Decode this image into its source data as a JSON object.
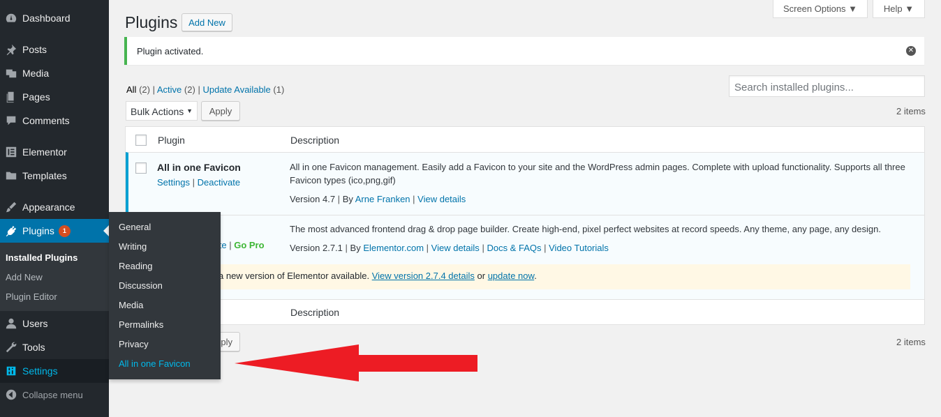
{
  "sidebar": {
    "dashboard": "Dashboard",
    "posts": "Posts",
    "media": "Media",
    "pages": "Pages",
    "comments": "Comments",
    "elementor": "Elementor",
    "templates": "Templates",
    "appearance": "Appearance",
    "plugins": "Plugins",
    "plugins_badge": "1",
    "submenu": [
      "Installed Plugins",
      "Add New",
      "Plugin Editor"
    ],
    "users": "Users",
    "tools": "Tools",
    "settings": "Settings",
    "collapse": "Collapse menu"
  },
  "flyout": [
    "General",
    "Writing",
    "Reading",
    "Discussion",
    "Media",
    "Permalinks",
    "Privacy",
    "All in one Favicon"
  ],
  "header": {
    "screen_options": "Screen Options ▼",
    "help": "Help ▼",
    "title": "Plugins",
    "add_new": "Add New"
  },
  "notice": {
    "text": "Plugin activated."
  },
  "filters": {
    "all": "All",
    "all_count": "(2)",
    "active": "Active",
    "active_count": "(2)",
    "update": "Update Available",
    "update_count": "(1)",
    "sep": "|"
  },
  "search": {
    "placeholder": "Search installed plugins..."
  },
  "bulk": {
    "select": "Bulk Actions",
    "apply": "Apply",
    "items": "2 items"
  },
  "table": {
    "col_plugin": "Plugin",
    "col_description": "Description",
    "rows": [
      {
        "name": "All in one Favicon",
        "actions": [
          "Settings",
          "Deactivate"
        ],
        "desc_line1": "All in one Favicon management. Easily add a Favicon to your site and the WordPress admin pages. Complete with upload functionality. Supports all three",
        "desc_line2": "Favicon types (ico,png,gif)",
        "version": "Version 4.7",
        "by": "By",
        "author": "Arne Franken",
        "view_details": "View details"
      },
      {
        "action_partial": "vate",
        "gopro": "Go Pro",
        "desc": "The most advanced frontend drag & drop page builder. Create high-end, pixel perfect websites at record speeds. Any theme, any page, any design.",
        "version": "Version 2.7.1",
        "by": "By",
        "author": "Elementor.com",
        "view_details": "View details",
        "docs": "Docs & FAQs",
        "tutorials": "Video Tutorials",
        "update_pre": "a new version of Elementor available.",
        "update_link": "View version 2.7.4 details",
        "update_or": "or",
        "update_now": "update now",
        "update_end": "."
      }
    ]
  },
  "bottom": {
    "apply_partial": "ply",
    "items": "2 items"
  }
}
